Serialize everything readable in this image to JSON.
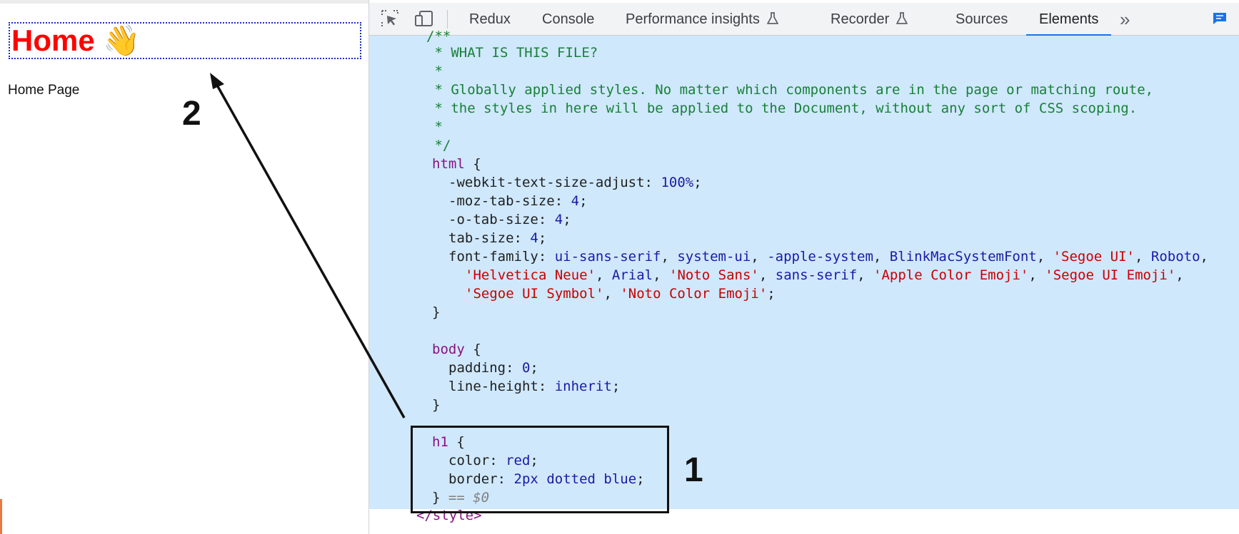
{
  "page": {
    "heading": "Home 👋",
    "text": "Home Page"
  },
  "toolbar": {
    "tabs": [
      {
        "label": "Redux"
      },
      {
        "label": "Console"
      },
      {
        "label": "Performance insights"
      },
      {
        "label": "Recorder"
      },
      {
        "label": "Sources"
      },
      {
        "label": "Elements",
        "active": true
      }
    ],
    "overflow": "»"
  },
  "code": {
    "l0": "/**",
    "l1": " * WHAT IS THIS FILE?",
    "l2": " *",
    "l3": " * Globally applied styles. No matter which components are in the page or matching route,",
    "l4": " * the styles in here will be applied to the Document, without any sort of CSS scoping.",
    "l5": " *",
    "l6": " */",
    "html_selector": "html",
    "brace_open": " {",
    "brace_close": "}",
    "p1_name": "-webkit-text-size-adjust",
    "p1_val": "100%",
    "p2_name": "-moz-tab-size",
    "p2_val": "4",
    "p3_name": "-o-tab-size",
    "p3_val": "4",
    "p4_name": "tab-size",
    "p4_val": "4",
    "ff_name": "font-family",
    "ff_1": "ui-sans-serif",
    "ff_2": "system-ui",
    "ff_3": "-apple-system",
    "ff_4": "BlinkMacSystemFont",
    "ff_5": "'Segoe UI'",
    "ff_6": "Roboto",
    "ff_7": "'Helvetica Neue'",
    "ff_8": "Arial",
    "ff_9": "'Noto Sans'",
    "ff_10": "sans-serif",
    "ff_11": "'Apple Color Emoji'",
    "ff_12": "'Segoe UI Emoji'",
    "ff_13": "'Segoe UI Symbol'",
    "ff_14": "'Noto Color Emoji'",
    "body_selector": "body",
    "b1_name": "padding",
    "b1_val": "0",
    "b2_name": "line-height",
    "b2_val": "inherit",
    "h1_selector": "h1",
    "h1_1_name": "color",
    "h1_1_val": "red",
    "h1_2_name": "border",
    "h1_2_val_num": "2px",
    "h1_2_val_rest": "dotted blue",
    "dollar": "== $0",
    "close_tag": "</style>"
  },
  "annotations": {
    "one": "1",
    "two": "2"
  },
  "colors": {
    "selection": "#cfe8fc",
    "heading": "#ff0000",
    "heading_border": "#1a2fc4",
    "active_tab": "#1a73e8"
  }
}
